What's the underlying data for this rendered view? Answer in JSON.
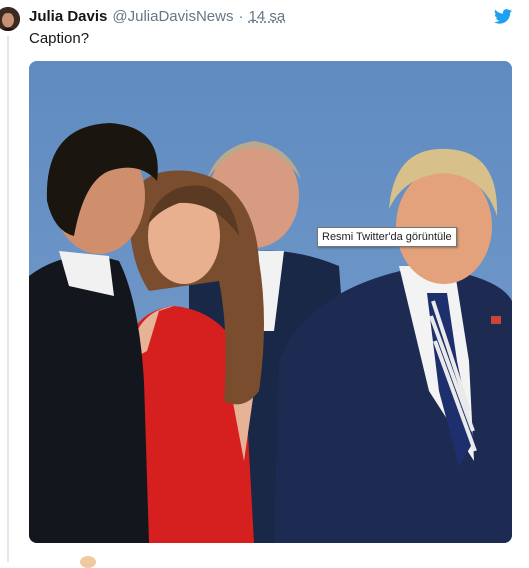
{
  "tweet": {
    "author_name": "Julia Davis",
    "handle": "@JuliaDavisNews",
    "separator": "·",
    "time": "14 sa",
    "text": "Caption?"
  },
  "tooltip": {
    "text": "Resmi Twitter'da görüntüle"
  },
  "icons": {
    "brand": "twitter-bird-icon"
  },
  "colors": {
    "brand_blue": "#1da1f2",
    "name_text": "#14171a",
    "meta_text": "#657786",
    "thread_line": "#e1e8ed",
    "sky": "#6a91c2"
  }
}
